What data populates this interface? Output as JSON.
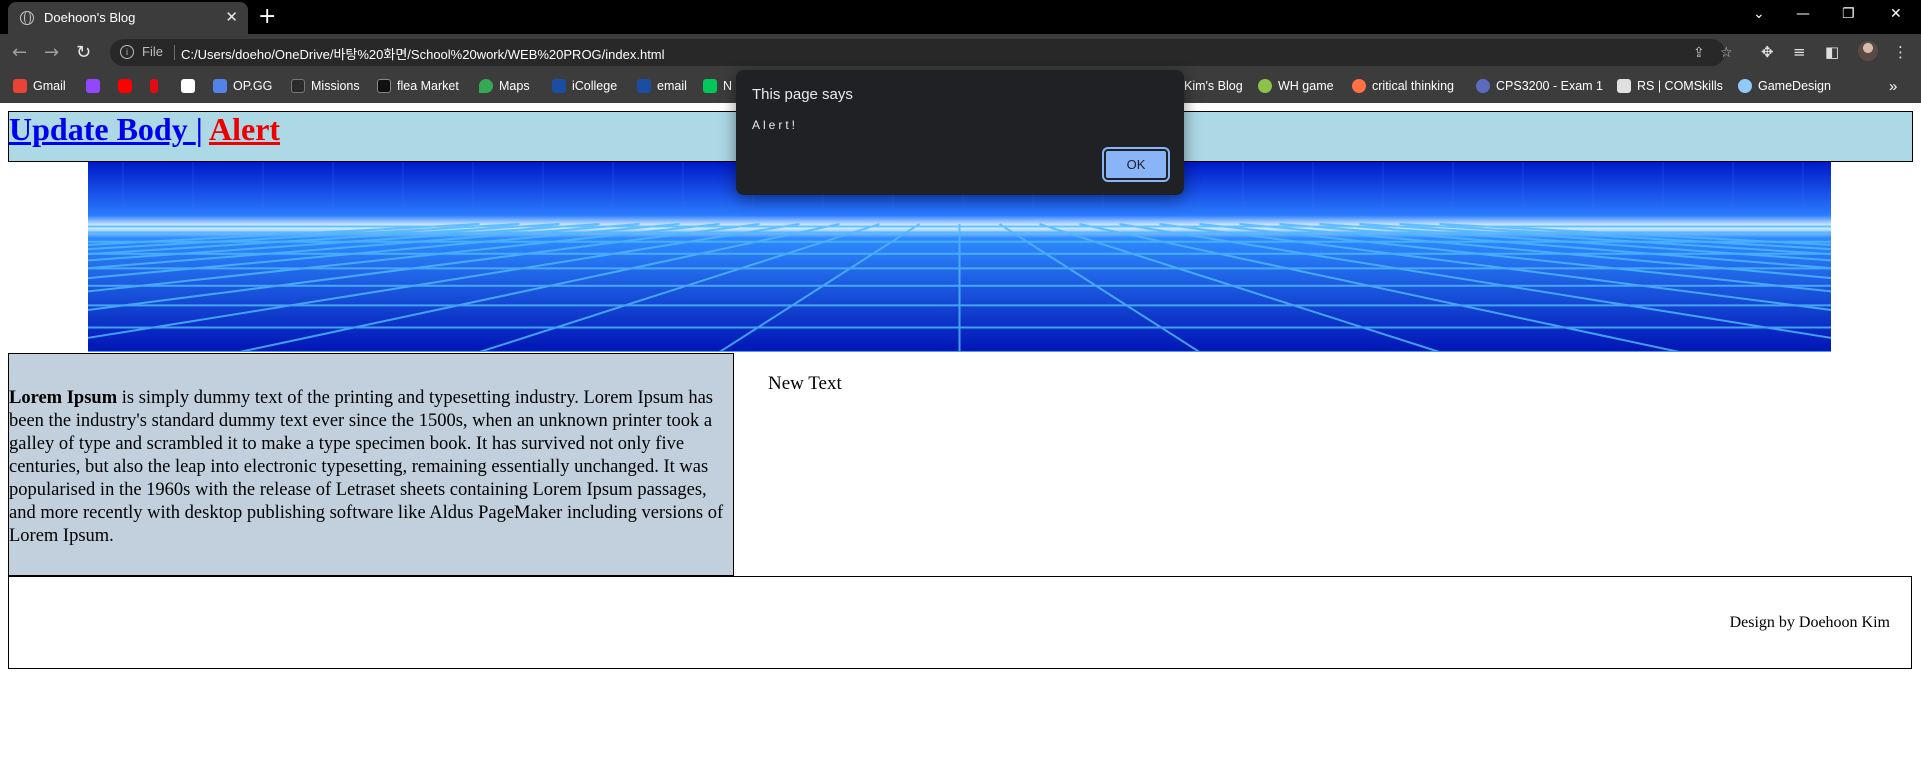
{
  "browser": {
    "tab_title": "Doehoon's Blog",
    "tab_close": "✕",
    "new_tab": "+",
    "window_controls": {
      "tab_search": "⌄",
      "minimize": "—",
      "restore": "❐",
      "close": "✕"
    },
    "nav": {
      "back": "←",
      "forward": "→",
      "reload": "↻"
    },
    "address": {
      "scheme_label": "File",
      "info_glyph": "i",
      "url": "C:/Users/doeho/OneDrive/바탕%20화면/School%20work/WEB%20PROG/index.html"
    },
    "bookmarks": [
      {
        "label": "Gmail",
        "icon": "gmail-icon",
        "color": "#ea4335"
      },
      {
        "label": "",
        "icon": "twitch-icon",
        "color": "#9146ff"
      },
      {
        "label": "",
        "icon": "youtube-icon",
        "color": "#ff0000"
      },
      {
        "label": "",
        "icon": "netflix-icon",
        "color": "#e50914"
      },
      {
        "label": "",
        "icon": "amazon-icon",
        "color": "#ffffff"
      },
      {
        "label": "OP.GG",
        "icon": "opgg-icon",
        "color": "#5383e8"
      },
      {
        "label": "Missions",
        "icon": "missions-icon",
        "color": "#2b2b2b"
      },
      {
        "label": "flea Market",
        "icon": "tarkov-market-icon",
        "color": "#111111"
      },
      {
        "label": "Maps",
        "icon": "maps-pin-icon",
        "color": "#34a853"
      },
      {
        "label": "iCollege",
        "icon": "icollege-icon",
        "color": "#1b4ea3"
      },
      {
        "label": "email",
        "icon": "email-icon",
        "color": "#1b4ea3"
      },
      {
        "label": "N",
        "icon": "naver-icon",
        "color": "#03c75a"
      },
      {
        "label": "Kim's Blog",
        "icon": "",
        "color": ""
      },
      {
        "label": "WH game",
        "icon": "wh-game-icon",
        "color": "#8bc34a"
      },
      {
        "label": "critical thinking",
        "icon": "critical-thinking-icon",
        "color": "#ff7043"
      },
      {
        "label": "CPS3200 - Exam 1",
        "icon": "quiz-icon",
        "color": "#5c6bc0"
      },
      {
        "label": "RS | COMSkills",
        "icon": "document-icon",
        "color": "#e0e0e0"
      },
      {
        "label": "GameDesign",
        "icon": "game-design-icon",
        "color": "#90caf9"
      }
    ],
    "bookmarks_overflow": "»"
  },
  "page": {
    "header": {
      "update_link": "Update Body ",
      "pipe": "|",
      "alert_link": "Alert"
    },
    "lorem": {
      "bold": "Lorem Ipsum",
      "rest": " is simply dummy text of the printing and typesetting industry. Lorem Ipsum has been the industry's standard dummy text ever since the 1500s, when an unknown printer took a galley of type and scrambled it to make a type specimen book. It has survived not only five centuries, but also the leap into electronic typesetting, remaining essentially unchanged. It was popularised in the 1960s with the release of Letraset sheets containing Lorem Ipsum passages, and more recently with desktop publishing software like Aldus PageMaker including versions of Lorem Ipsum."
    },
    "new_text": "New Text",
    "footer_credit": "Design by Doehoon Kim",
    "colors": {
      "header_bg": "#add8e6",
      "lorem_bg": "#c1d0dc",
      "link": "#0000ee",
      "alert_link": "#ee0000"
    }
  },
  "dialog": {
    "title": "This page says",
    "message": "Alert!",
    "ok": "OK"
  }
}
